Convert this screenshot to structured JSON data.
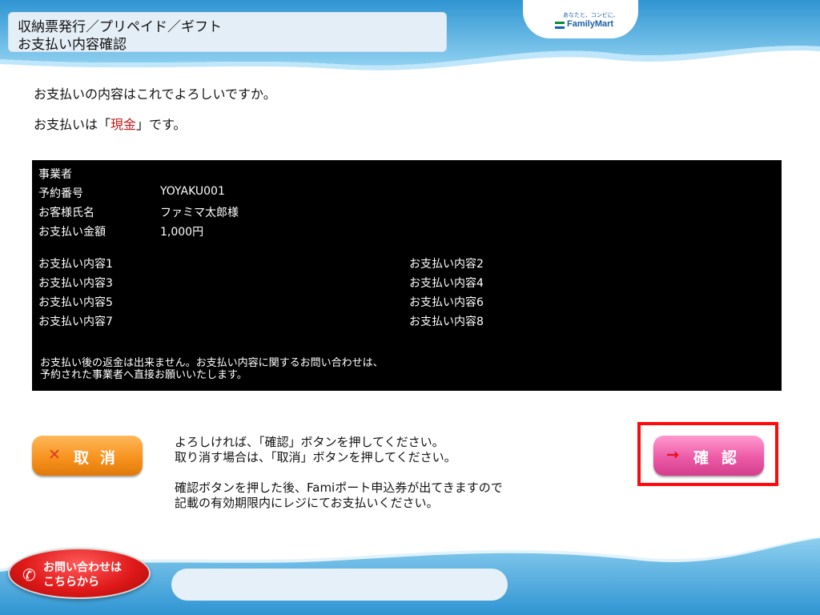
{
  "header": {
    "title_line1": "収納票発行／プリペイド／ギフト",
    "title_line2": "お支払い内容確認",
    "logo_tagline": "あなたと、コンビに、",
    "logo_text": "FamilyMart"
  },
  "prompt": {
    "question": "お支払いの内容はこれでよろしいですか。",
    "method_prefix": "お支払いは「",
    "method_value": "現金",
    "method_suffix": "」です。"
  },
  "details": {
    "business_label": "事業者",
    "fields": [
      {
        "label": "予約番号",
        "value": "YOYAKU001"
      },
      {
        "label": "お客様氏名",
        "value": "ファミマ太郎様"
      },
      {
        "label": "お支払い金額",
        "value": "1,000円"
      }
    ],
    "contents": [
      "お支払い内容1",
      "お支払い内容2",
      "お支払い内容3",
      "お支払い内容4",
      "お支払い内容5",
      "お支払い内容6",
      "お支払い内容7",
      "お支払い内容8"
    ],
    "note_line1": "お支払い後の返金は出来ません。お支払い内容に関するお問い合わせは、",
    "note_line2": "予約された事業者へ直接お願いいたします。"
  },
  "buttons": {
    "cancel_label": "取消",
    "confirm_label": "確認",
    "cancel_icon": "x-icon",
    "confirm_icon": "right-arrow-icon"
  },
  "instructions": {
    "line1": "よろしければ、「確認」ボタンを押してください。",
    "line2": "取り消す場合は、「取消」ボタンを押してください。",
    "line3": "確認ボタンを押した後、Famiポート申込券が出てきますので",
    "line4": "記載の有効期限内にレジにてお支払いください。"
  },
  "footer": {
    "inquiry_line1": "お問い合わせは",
    "inquiry_line2": "こちらから"
  },
  "colors": {
    "accent_red": "#c0201e",
    "highlight_frame": "#ff0a0a",
    "cancel_button": "#f7931e",
    "confirm_button": "#ec5aa6",
    "panel_bg": "#000000",
    "wave_blue": "#3fa5da"
  }
}
